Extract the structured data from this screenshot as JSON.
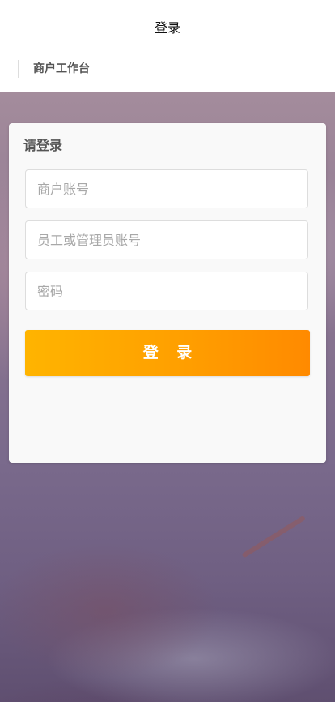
{
  "navbar": {
    "title": "登录"
  },
  "subheader": {
    "label": "商户工作台"
  },
  "login_card": {
    "title": "请登录",
    "merchant_account": {
      "placeholder": "商户账号",
      "value": ""
    },
    "staff_account": {
      "placeholder": "员工或管理员账号",
      "value": ""
    },
    "password": {
      "placeholder": "密码",
      "value": ""
    },
    "login_button_label": "登 录"
  },
  "colors": {
    "accent_start": "#ffb400",
    "accent_end": "#ff8a00",
    "card_bg": "#f9f9f9",
    "text_muted": "#555555"
  }
}
